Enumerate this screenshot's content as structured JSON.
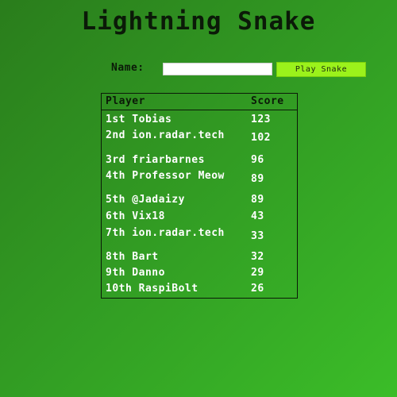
{
  "title": "Lightning Snake",
  "form": {
    "name_label": "Name:",
    "name_value": "",
    "play_label": "Play Snake"
  },
  "leaderboard": {
    "headers": {
      "player": "Player",
      "score": "Score"
    },
    "rows": [
      {
        "player": "1st Tobias",
        "score": "123"
      },
      {
        "player": "2nd ion.radar.tech",
        "score": "102"
      },
      {
        "player": "3rd friarbarnes",
        "score": "96"
      },
      {
        "player": "4th Professor Meow",
        "score": "89"
      },
      {
        "player": "5th @Jadaizy",
        "score": "89"
      },
      {
        "player": "6th Vix18",
        "score": "43"
      },
      {
        "player": "7th ion.radar.tech",
        "score": "33"
      },
      {
        "player": "8th Bart",
        "score": "32"
      },
      {
        "player": "9th Danno",
        "score": "29"
      },
      {
        "player": "10th RaspiBolt",
        "score": "26"
      }
    ]
  }
}
